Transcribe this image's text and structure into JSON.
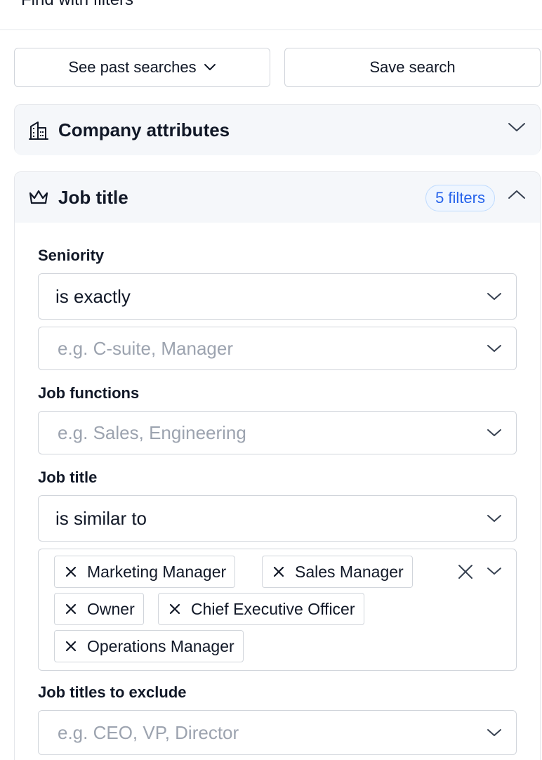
{
  "header": {
    "title": "Find with filters"
  },
  "actions": {
    "past_searches": "See past searches",
    "save_search": "Save search"
  },
  "company_section": {
    "title": "Company attributes"
  },
  "job_section": {
    "title": "Job title",
    "badge": "5 filters",
    "seniority": {
      "label": "Seniority",
      "operator": "is exactly",
      "placeholder": "e.g. C-suite, Manager"
    },
    "job_functions": {
      "label": "Job functions",
      "placeholder": "e.g. Sales, Engineering"
    },
    "job_title": {
      "label": "Job title",
      "operator": "is similar to",
      "tags": [
        "Marketing Manager",
        "Sales Manager",
        "Owner",
        "Chief Executive Officer",
        "Operations Manager"
      ]
    },
    "exclude": {
      "label": "Job titles to exclude",
      "placeholder": "e.g. CEO, VP, Director"
    }
  }
}
